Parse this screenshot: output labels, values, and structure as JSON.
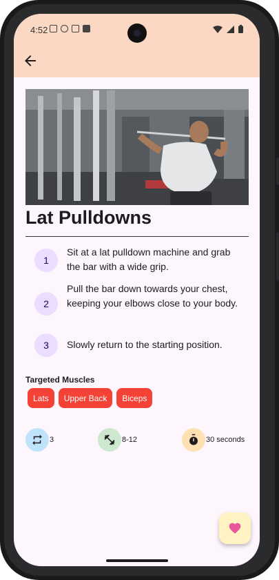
{
  "status_bar": {
    "time": "4:52"
  },
  "exercise": {
    "title": "Lat Pulldowns",
    "steps": [
      {
        "number": "1",
        "text": "Sit at a lat pulldown machine and grab the bar with a wide grip."
      },
      {
        "number": "2",
        "text": "Pull the bar down towards your chest, keeping your elbows close to your body."
      },
      {
        "number": "3",
        "text": "Slowly return to the starting position."
      }
    ],
    "targeted_muscles_label": "Targeted Muscles",
    "muscles": [
      "Lats",
      "Upper Back",
      "Biceps"
    ],
    "stats": {
      "sets": "3",
      "reps": "8-12",
      "rest": "30 seconds"
    }
  },
  "colors": {
    "appbar": "#fbd8c4",
    "chip": "#f44336",
    "step_circle": "#eaddff",
    "sets_icon_bg": "#bfe3f8",
    "reps_icon_bg": "#cde8cf",
    "rest_icon_bg": "#fde1b3",
    "fab": "#fff3c4",
    "heart": "#e8559a"
  },
  "icons": {
    "back": "arrow-back-icon",
    "sets": "repeat-icon",
    "reps": "dumbbell-icon",
    "rest": "timer-icon",
    "favorite": "heart-icon"
  }
}
